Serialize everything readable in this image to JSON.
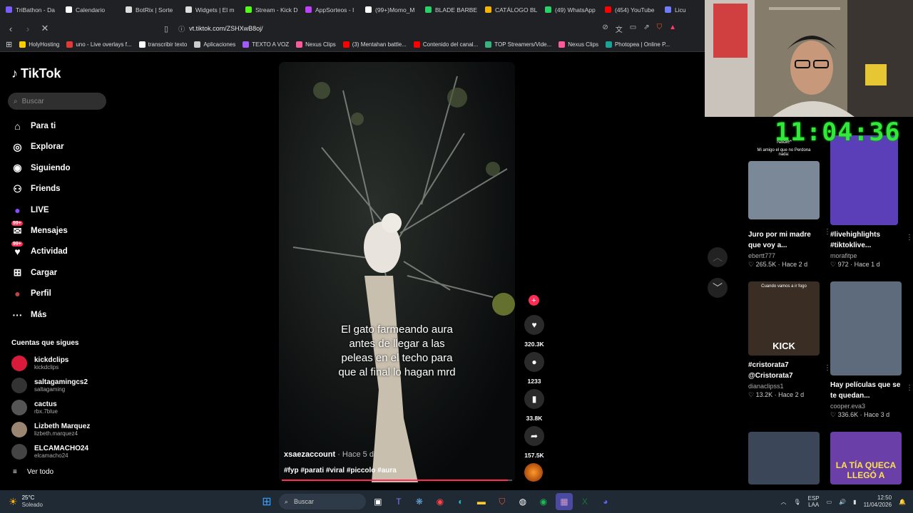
{
  "tabs": [
    {
      "label": "TriBathon - Da",
      "color": "#7b5cff"
    },
    {
      "label": "Calendario",
      "color": "#ffffff"
    },
    {
      "label": "BotRix | Sorte",
      "color": "#dddddd"
    },
    {
      "label": "Widgets | El m",
      "color": "#dddddd"
    },
    {
      "label": "Stream - Kick D",
      "color": "#53fc18"
    },
    {
      "label": "AppSorteos - I",
      "color": "#c040ff"
    },
    {
      "label": "(99+)Momo_M",
      "color": "#ffffff"
    },
    {
      "label": "BLADE BARBE",
      "color": "#25d366"
    },
    {
      "label": "CATÁLOGO BL",
      "color": "#f4b400"
    },
    {
      "label": "(49) WhatsApp",
      "color": "#25d366"
    },
    {
      "label": "(454) YouTube",
      "color": "#ff0000"
    },
    {
      "label": "Licu",
      "color": "#6f7cff"
    }
  ],
  "address": {
    "url": "vt.tiktok.com/ZSHXwB8oj/"
  },
  "bookmarks": [
    {
      "label": "HolyHosting",
      "color": "#ffcc00"
    },
    {
      "label": "uno - Live overlays f...",
      "color": "#e53935"
    },
    {
      "label": "transcribir texto",
      "color": "#ffffff"
    },
    {
      "label": "Aplicaciones",
      "color": "#cccccc"
    },
    {
      "label": "TEXTO A VOZ",
      "color": "#a259ff"
    },
    {
      "label": "Nexus Clips",
      "color": "#ff5b9a"
    },
    {
      "label": "(3) Mentahan battle...",
      "color": "#ff0000"
    },
    {
      "label": "Contenido del canal...",
      "color": "#ff0000"
    },
    {
      "label": "TOP Streamers/Vide...",
      "color": "#36b37e"
    },
    {
      "label": "Nexus Clips",
      "color": "#ff5b9a"
    },
    {
      "label": "Photopea | Online P...",
      "color": "#18a497"
    }
  ],
  "sidebar": {
    "logo": "TikTok",
    "search_placeholder": "Buscar",
    "nav": [
      {
        "label": "Para ti",
        "icon": "home-icon",
        "glyph": "⌂"
      },
      {
        "label": "Explorar",
        "icon": "compass-icon",
        "glyph": "◎"
      },
      {
        "label": "Siguiendo",
        "icon": "following-avatar-icon",
        "glyph": "◉"
      },
      {
        "label": "Friends",
        "icon": "friends-icon",
        "glyph": "⚇"
      },
      {
        "label": "LIVE",
        "icon": "live-icon",
        "glyph": "●"
      },
      {
        "label": "Mensajes",
        "icon": "messages-icon",
        "glyph": "✉",
        "badge": "99+"
      },
      {
        "label": "Actividad",
        "icon": "activity-icon",
        "glyph": "♥",
        "badge": "99+"
      },
      {
        "label": "Cargar",
        "icon": "upload-icon",
        "glyph": "⊞"
      },
      {
        "label": "Perfil",
        "icon": "profile-icon",
        "glyph": "●"
      },
      {
        "label": "Más",
        "icon": "more-icon",
        "glyph": "···"
      }
    ],
    "following_title": "Cuentas que sigues",
    "following": [
      {
        "name": "kickdclips",
        "handle": "kickdclips",
        "color": "#d81b3b"
      },
      {
        "name": "saltagamingcs2",
        "handle": "saltagaming",
        "color": "#333333"
      },
      {
        "name": "cactus",
        "handle": "rbx.7blue",
        "color": "#555555"
      },
      {
        "name": "Lizbeth Marquez",
        "handle": "lizbeth.marquez4",
        "color": "#9a8573"
      },
      {
        "name": "ELCAMACHO24",
        "handle": "elcamacho24",
        "color": "#444444"
      }
    ],
    "see_all": "Ver todo"
  },
  "video": {
    "caption": "El gato farmeando aura antes de llegar a las peleas en el techo para que al final lo hagan mrd",
    "author": "xsaezaccount",
    "time": " · Hace 5 d",
    "hashtags": "#fyp #parati #viral #piccolo #aura",
    "progress": 0.98,
    "likes": "320.3K",
    "comments": "1233",
    "saves": "33.8K",
    "shares": "157.5K"
  },
  "clock": "11:04:36",
  "cards": [
    {
      "title": "Juro por mi madre que voy a...",
      "author": "ebertt777",
      "stats": "♡ 265.5K · Hace 2 d",
      "overlay_text": "Nadie*",
      "overlay_sub": "Mi amigo el que no Perdona nada:",
      "thumb": "#7a8898"
    },
    {
      "title": "#livehighlights #tiktoklive...",
      "author": "morafitpe",
      "stats": "♡ 972 · Hace 1 d",
      "overlay_text": "",
      "overlay_sub": "",
      "thumb": "#5b3fb8"
    },
    {
      "title": "#cristorata7 @Cristorata7",
      "author": "dianaclipss1",
      "stats": "♡ 13.2K · Hace 2 d",
      "overlay_text": "KICK",
      "overlay_sub": "Cuando vamos a ir fogo",
      "thumb": "#3a2e24"
    },
    {
      "title": "Hay películas que se te quedan...",
      "author": "cooper.eva3",
      "stats": "♡ 336.6K · Hace 3 d",
      "overlay_text": "",
      "overlay_sub": "",
      "thumb": "#5d6b7c"
    },
    {
      "title": "",
      "author": "",
      "stats": "",
      "overlay_text": "",
      "overlay_sub": "",
      "thumb": "#3b4658"
    },
    {
      "title": "",
      "author": "",
      "stats": "",
      "overlay_text": "LA TÍA QUECA LLEGÓ A",
      "overlay_sub": "",
      "thumb": "#6b3fa8"
    }
  ],
  "weather": {
    "temp": "25°C",
    "desc": "Soleado"
  },
  "taskbar": {
    "search": "Buscar",
    "lang": "ESP",
    "lang2": "LAA",
    "time": "12:50",
    "date": "11/04/2026"
  }
}
